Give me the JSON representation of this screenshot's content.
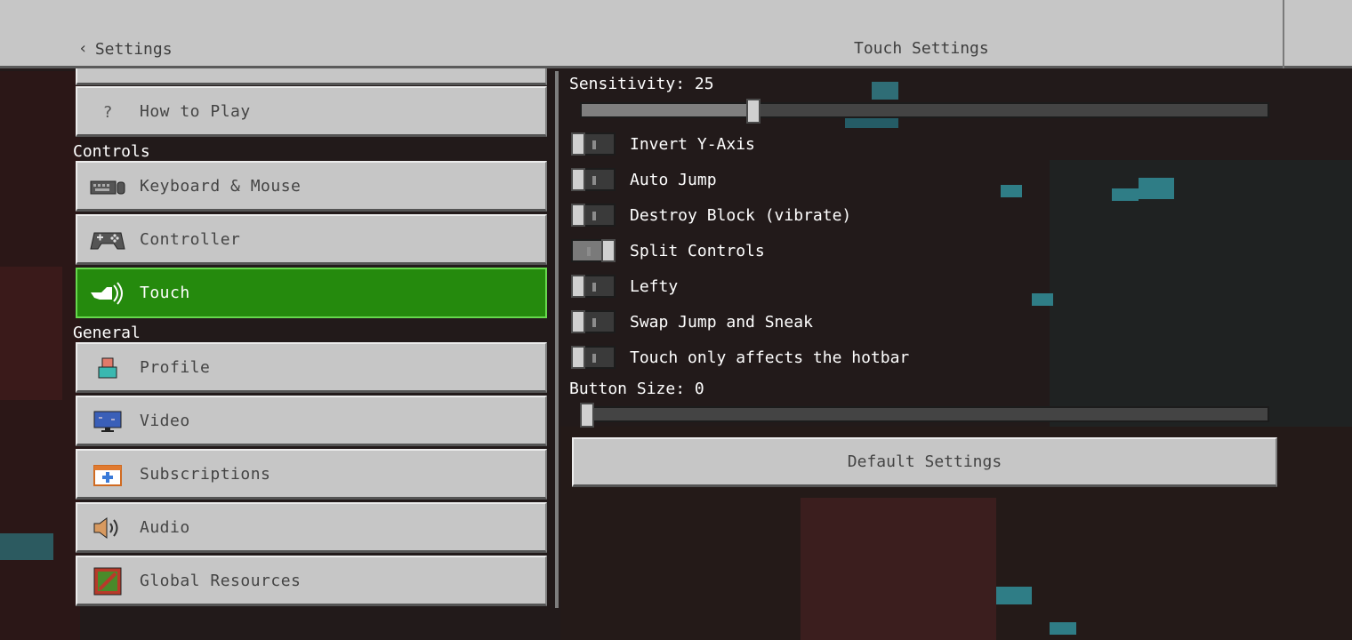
{
  "header": {
    "back_label": "Settings",
    "page_title": "Touch Settings"
  },
  "sidebar": {
    "sections": {
      "controls": "Controls",
      "general": "General"
    },
    "items": [
      {
        "label": "How to Play",
        "icon": "question-icon"
      },
      {
        "label": "Keyboard & Mouse",
        "icon": "keyboard-mouse-icon"
      },
      {
        "label": "Controller",
        "icon": "gamepad-icon"
      },
      {
        "label": "Touch",
        "icon": "touch-hand-icon",
        "active": true
      },
      {
        "label": "Profile",
        "icon": "profile-icon"
      },
      {
        "label": "Video",
        "icon": "monitor-icon"
      },
      {
        "label": "Subscriptions",
        "icon": "calendar-plus-icon"
      },
      {
        "label": "Audio",
        "icon": "speaker-icon"
      },
      {
        "label": "Global Resources",
        "icon": "resources-icon"
      }
    ]
  },
  "touch": {
    "sensitivity": {
      "label": "Sensitivity: 25",
      "value": 25,
      "min": 0,
      "max": 100
    },
    "toggles": [
      {
        "label": "Invert Y-Axis",
        "on": false
      },
      {
        "label": "Auto Jump",
        "on": false
      },
      {
        "label": "Destroy Block (vibrate)",
        "on": false
      },
      {
        "label": "Split Controls",
        "on": true
      },
      {
        "label": "Lefty",
        "on": false
      },
      {
        "label": "Swap Jump and Sneak",
        "on": false
      },
      {
        "label": "Touch only affects the hotbar",
        "on": false
      }
    ],
    "button_size": {
      "label": "Button Size: 0",
      "value": 0,
      "min": 0,
      "max": 100
    },
    "default_button": "Default Settings"
  },
  "colors": {
    "active_green": "#258a0d",
    "button_grey": "#c6c6c6"
  }
}
